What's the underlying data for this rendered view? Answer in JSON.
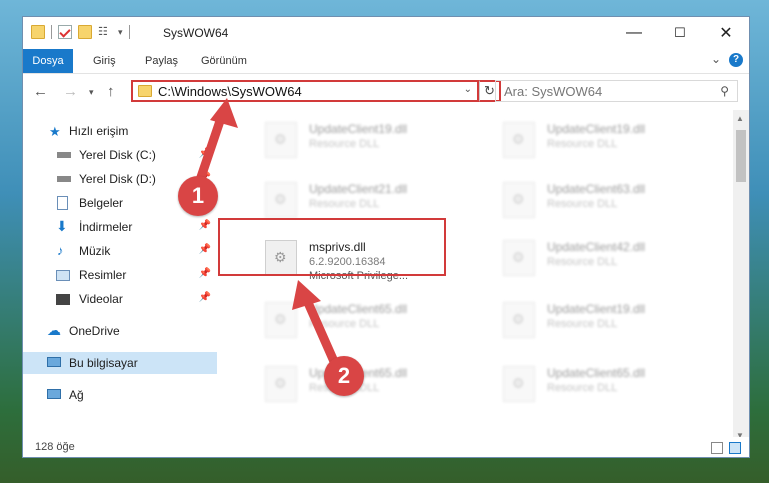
{
  "window": {
    "title": "SysWOW64",
    "controls": {
      "minimize": "—",
      "maximize": "☐",
      "close": "✕"
    }
  },
  "ribbon": {
    "tabs": [
      "Dosya",
      "Giriş",
      "Paylaş",
      "Görünüm"
    ],
    "help": "?"
  },
  "nav": {
    "address": "C:\\Windows\\SysWOW64",
    "search_placeholder": "Ara: SysWOW64"
  },
  "sidebar": {
    "items": [
      {
        "label": "Hızlı erişim",
        "icon": "star-icon"
      },
      {
        "label": "Yerel Disk (C:)",
        "icon": "drive-icon"
      },
      {
        "label": "Yerel Disk (D:)",
        "icon": "drive-icon"
      },
      {
        "label": "Belgeler",
        "icon": "documents-icon"
      },
      {
        "label": "İndirmeler",
        "icon": "download-icon"
      },
      {
        "label": "Müzik",
        "icon": "music-icon"
      },
      {
        "label": "Resimler",
        "icon": "pictures-icon"
      },
      {
        "label": "Videolar",
        "icon": "video-icon"
      },
      {
        "label": "OneDrive",
        "icon": "cloud-icon"
      },
      {
        "label": "Bu bilgisayar",
        "icon": "computer-icon"
      },
      {
        "label": "Ağ",
        "icon": "network-icon"
      }
    ]
  },
  "files": [
    {
      "name": "UpdateClient19.dll",
      "type": "Resource DLL"
    },
    {
      "name": "UpdateClient19.dll",
      "type": "Resource DLL"
    },
    {
      "name": "UpdateClient21.dll",
      "type": "Resource DLL"
    },
    {
      "name": "UpdateClient63.dll",
      "type": "Resource DLL"
    },
    {
      "name": "msprivs.dll",
      "version": "6.2.9200.16384",
      "desc": "Microsoft Privilege..."
    },
    {
      "name": "UpdateClient42.dll",
      "type": "Resource DLL"
    },
    {
      "name": "UpdateClient65.dll",
      "type": "Resource DLL"
    },
    {
      "name": "UpdateClient19.dll",
      "type": "Resource DLL"
    },
    {
      "name": "UpdateClient65.dll",
      "type": "Resource DLL"
    },
    {
      "name": "UpdateClient65.dll",
      "type": "Resource DLL"
    }
  ],
  "status": {
    "count": "128 öğe"
  },
  "annotations": {
    "badge1": "1",
    "badge2": "2",
    "accent": "#d94545"
  },
  "colors": {
    "accent": "#1979ca",
    "highlight": "#d23a3a"
  }
}
